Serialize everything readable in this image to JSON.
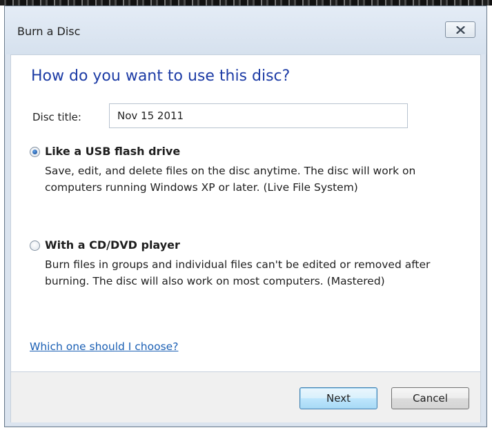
{
  "window": {
    "title": "Burn a Disc",
    "close_icon": "close-icon"
  },
  "main": {
    "heading": "How do you want to use this disc?",
    "disc_title_label": "Disc title:",
    "disc_title_value": "Nov 15 2011",
    "options": [
      {
        "label": "Like a USB flash drive",
        "description": "Save, edit, and delete files on the disc anytime. The disc will work on computers running Windows XP or later. (Live File System)",
        "selected": true
      },
      {
        "label": "With a CD/DVD player",
        "description": "Burn files in groups and individual files can't be edited or removed after burning. The disc will also work on most computers. (Mastered)",
        "selected": false
      }
    ],
    "help_link": "Which one should I choose?"
  },
  "footer": {
    "next_label": "Next",
    "cancel_label": "Cancel"
  },
  "colors": {
    "heading": "#1c3ba5",
    "link": "#1a5fb4",
    "default_button_border": "#3c7fb1"
  }
}
